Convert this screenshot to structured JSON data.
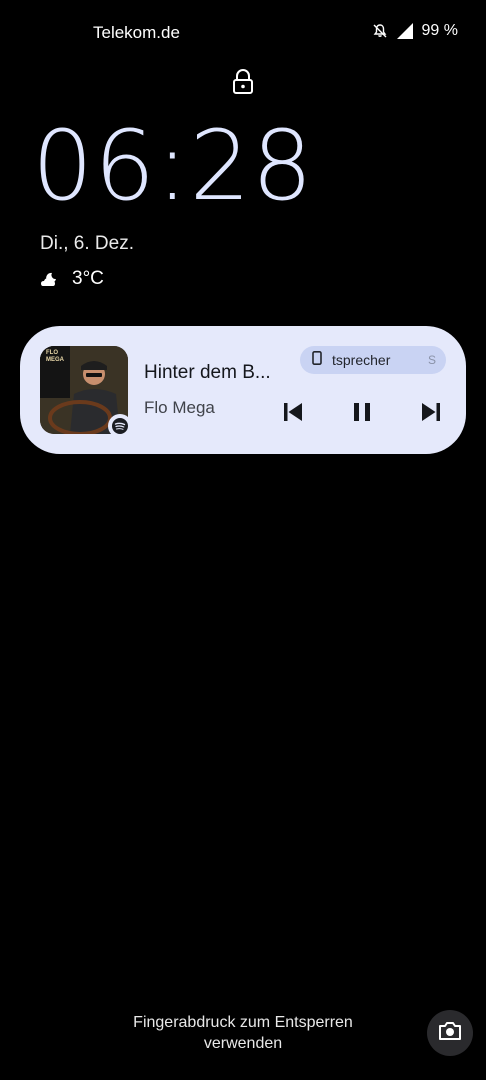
{
  "status_bar": {
    "carrier": "Telekom.de",
    "battery": "99 %",
    "icons": [
      "bell-off-icon",
      "signal-icon"
    ]
  },
  "lock_screen": {
    "lock_icon": "lock-icon",
    "time": "06:28",
    "date": "Di., 6. Dez.",
    "weather": {
      "icon": "cloud-moon-icon",
      "temperature": "3°C"
    }
  },
  "media": {
    "title": "Hinter dem B...",
    "artist": "Flo Mega",
    "album_art_text": "FLO MEGA",
    "app_badge": "spotify-icon",
    "output_device": "tsprecher",
    "colors": {
      "card": "#e5e9fb",
      "chip": "#c9d3f3"
    },
    "controls": [
      "previous-icon",
      "pause-icon",
      "next-icon"
    ]
  },
  "footer": {
    "unlock_hint_line1": "Fingerabdruck zum Entsperren",
    "unlock_hint_line2": "verwenden",
    "camera_icon": "camera-icon"
  }
}
